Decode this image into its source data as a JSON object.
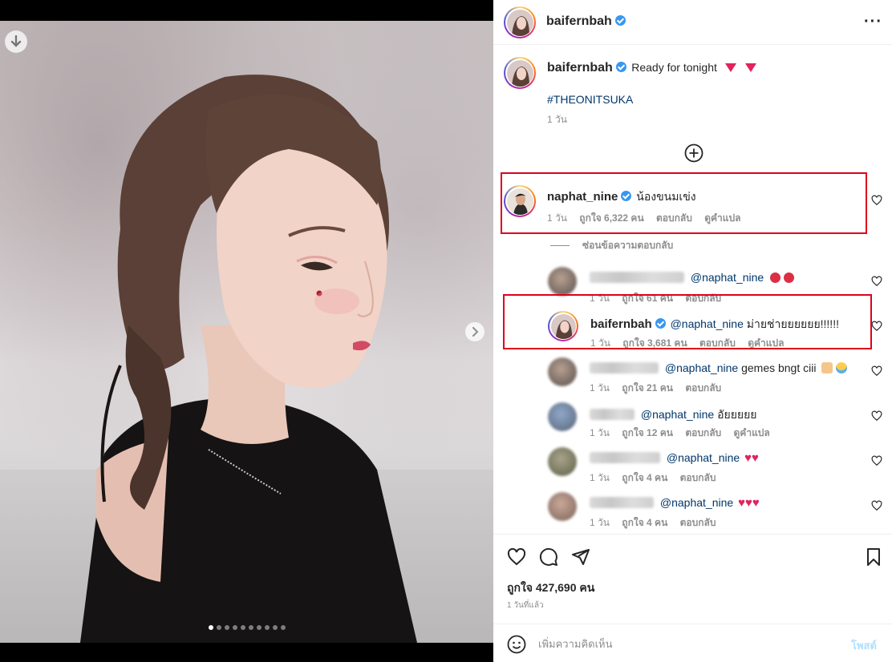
{
  "post": {
    "author": "baifernbah",
    "caption_text": "Ready for tonight",
    "caption_emojis": [
      "red-down-triangle",
      "red-down-triangle"
    ],
    "hashtag": "#THEONITSUKA",
    "caption_time": "1 วัน",
    "carousel": {
      "total": 10,
      "current": 1
    },
    "likes": "ถูกใจ 427,690 คน",
    "time_ago": "1 วันที่แล้ว"
  },
  "comments": {
    "main": {
      "user": "naphat_nine",
      "text": "น้องขนมเข่ง",
      "time": "1 วัน",
      "likes": "ถูกใจ 6,322 คน",
      "reply": "ตอบกลับ",
      "translate": "ดูคำแปล"
    },
    "hide_replies": "ซ่อนข้อความตอบกลับ",
    "replies": [
      {
        "user_blurred": true,
        "mention": "@naphat_nine",
        "text": "",
        "emojis": [
          "red-circle",
          "red-circle"
        ],
        "time": "1 วัน",
        "likes": "ถูกใจ 61 คน",
        "reply": "ตอบกลับ"
      },
      {
        "user": "baifernbah",
        "mention": "@naphat_nine",
        "text": "ม่ายช่ายยยยยย!!!!!!",
        "time": "1 วัน",
        "likes": "ถูกใจ 3,681 คน",
        "reply": "ตอบกลับ",
        "translate": "ดูคำแปล"
      },
      {
        "user_blurred": true,
        "mention": "@naphat_nine",
        "text": "gemes bngt ciii",
        "emojis": [
          "pinching-hand",
          "crying-face"
        ],
        "time": "1 วัน",
        "likes": "ถูกใจ 21 คน",
        "reply": "ตอบกลับ"
      },
      {
        "user_blurred": true,
        "mention": "@naphat_nine",
        "text": "อัยยยยย",
        "time": "1 วัน",
        "likes": "ถูกใจ 12 คน",
        "reply": "ตอบกลับ",
        "translate": "ดูคำแปล"
      },
      {
        "user_blurred": true,
        "mention": "@naphat_nine",
        "text": "",
        "emojis": [
          "red-heart",
          "red-heart"
        ],
        "time": "1 วัน",
        "likes": "ถูกใจ 4 คน",
        "reply": "ตอบกลับ"
      },
      {
        "user_blurred": true,
        "mention": "@naphat_nine",
        "text": "",
        "emojis": [
          "red-heart",
          "red-heart",
          "red-heart"
        ],
        "time": "1 วัน",
        "likes": "ถูกใจ 4 คน",
        "reply": "ตอบกลับ"
      }
    ]
  },
  "add_comment": {
    "placeholder": "เพิ่มความคิดเห็น",
    "post_label": "โพสต์"
  },
  "colors": {
    "verified": "#3897f0",
    "highlight_box": "#e0001b",
    "link": "#00376b",
    "post_disabled": "#b2dffc"
  }
}
